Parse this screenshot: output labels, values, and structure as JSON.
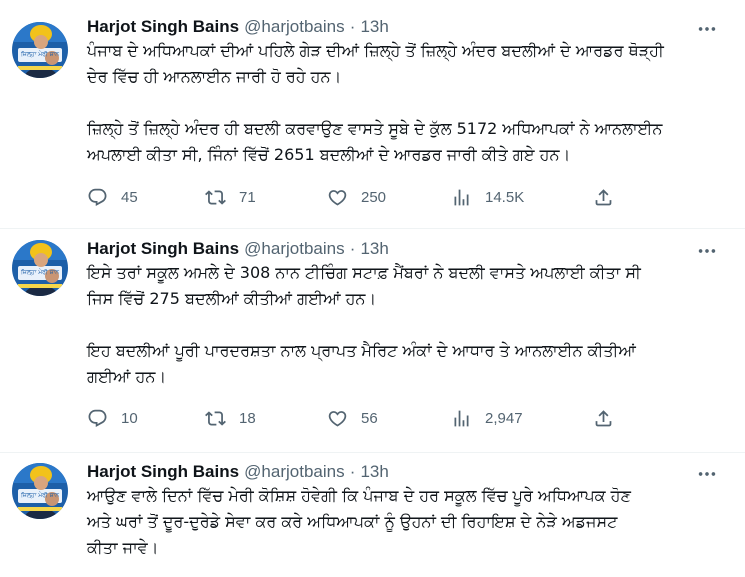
{
  "tweets": [
    {
      "name": "Harjot Singh Bains",
      "handle": "@harjotbains",
      "separator": "·",
      "time": "13h",
      "avatar_caption": "ਜ਼ਿਲ੍ਹਾ ਮੇਰੀ ਸ਼ਾਨ",
      "text": "ਪੰਜਾਬ ਦੇ ਅਧਿਆਪਕਾਂ ਦੀਆਂ ਪਹਿਲੇ ਗੇੜ ਦੀਆਂ ਜ਼ਿਲ੍ਹੇ ਤੋਂ ਜ਼ਿਲ੍ਹੇ ਅੰਦਰ ਬਦਲੀਆਂ ਦੇ ਆਰਡਰ ਥੋੜ੍ਹੀ\nਦੇਰ ਵਿੱਚ ਹੀ ਆਨਲਾਈਨ ਜਾਰੀ ਹੋ ਰਹੇ ਹਨ।\n\nਜ਼ਿਲ੍ਹੇ ਤੋਂ ਜ਼ਿਲ੍ਹੇ ਅੰਦਰ ਹੀ ਬਦਲੀ ਕਰਵਾਉਣ ਵਾਸਤੇ ਸੂਬੇ ਦੇ ਕੁੱਲ 5172 ਅਧਿਆਪਕਾਂ ਨੇ ਆਨਲਾਈਨ\nਅਪਲਾਈ ਕੀਤਾ ਸੀ, ਜਿੰਨਾਂ ਵਿੱਚੋਂ 2651 ਬਦਲੀਆਂ ਦੇ ਆਰਡਰ ਜਾਰੀ ਕੀਤੇ ਗਏ ਹਨ।",
      "replies": "45",
      "retweets": "71",
      "likes": "250",
      "views": "14.5K"
    },
    {
      "name": "Harjot Singh Bains",
      "handle": "@harjotbains",
      "separator": "·",
      "time": "13h",
      "avatar_caption": "ਜ਼ਿਲ੍ਹਾ ਮੇਰੀ ਸ਼ਾਨ",
      "text": "ਇਸੇ ਤਰਾਂ ਸਕੂਲ ਅਮਲੇ ਦੇ 308 ਨਾਨ ਟੀਚਿੰਗ ਸਟਾਫ਼ ਮੈਂਬਰਾਂ ਨੇ ਬਦਲੀ ਵਾਸਤੇ ਅਪਲਾਈ ਕੀਤਾ ਸੀ\nਜਿਸ ਵਿੱਚੋਂ 275 ਬਦਲੀਆਂ ਕੀਤੀਆਂ ਗਈਆਂ ਹਨ।\n\nਇਹ ਬਦਲੀਆਂ ਪੂਰੀ ਪਾਰਦਰਸ਼ਤਾ ਨਾਲ ਪ੍ਰਾਪਤ ਮੈਰਿਟ ਅੰਕਾਂ ਦੇ ਆਧਾਰ ਤੇ ਆਨਲਾਈਨ ਕੀਤੀਆਂ\nਗਈਆਂ ਹਨ।",
      "replies": "10",
      "retweets": "18",
      "likes": "56",
      "views": "2,947"
    },
    {
      "name": "Harjot Singh Bains",
      "handle": "@harjotbains",
      "separator": "·",
      "time": "13h",
      "avatar_caption": "ਜ਼ਿਲ੍ਹਾ ਮੇਰੀ ਸ਼ਾਨ",
      "text": "ਆਉਣ ਵਾਲੇ ਦਿਨਾਂ ਵਿੱਚ ਮੇਰੀ ਕੋਸ਼ਿਸ਼ ਹੋਵੇਗੀ ਕਿ ਪੰਜਾਬ ਦੇ ਹਰ ਸਕੂਲ ਵਿੱਚ ਪੂਰੇ ਅਧਿਆਪਕ ਹੋਣ\nਅਤੇ ਘਰਾਂ ਤੋਂ ਦੂਰ-ਦੁਰੇਡੇ ਸੇਵਾ ਕਰ ਕਰੇ ਅਧਿਆਪਕਾਂ ਨੂੰ ਉਹਨਾਂ ਦੀ ਰਿਹਾਇਸ਼ ਦੇ ਨੇੜੇ ਅਡਜਸਟ\nਕੀਤਾ ਜਾਵੇ।"
    }
  ],
  "colors": {
    "text": "#0f1419",
    "secondary": "#536471",
    "divider": "#eff3f4",
    "turban": "#f2c21b",
    "avatar_bg": "#1d5fa8"
  },
  "icons": [
    "reply-icon",
    "retweet-icon",
    "like-icon",
    "views-icon",
    "share-icon",
    "more-icon"
  ]
}
